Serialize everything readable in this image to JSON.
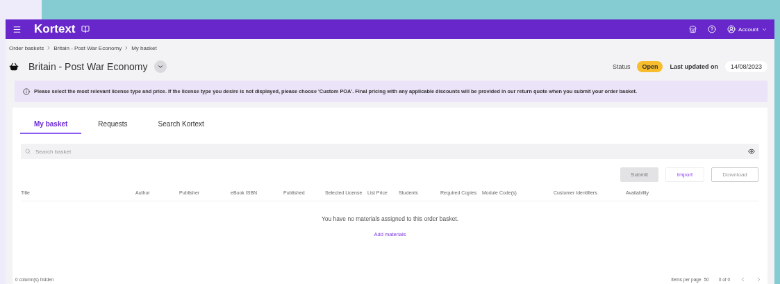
{
  "header": {
    "brand": "Kortext",
    "account": "Account"
  },
  "breadcrumbs": [
    "Order baskets",
    "Britain - Post War Economy",
    "My basket"
  ],
  "title": "Britain - Post War Economy",
  "status": {
    "label": "Status",
    "value": "Open"
  },
  "last_updated": {
    "label": "Last updated on",
    "value": "14/08/2023"
  },
  "notice": "Please select the most relevant license type and price. If the license type you desire is not displayed, please choose 'Custom POA'. Final pricing with any applicable discounts will be provided in our return quote when you submit your order basket.",
  "tabs": [
    {
      "label": "My basket",
      "selected": true
    },
    {
      "label": "Requests",
      "selected": false
    },
    {
      "label": "Search Kortext",
      "selected": false
    }
  ],
  "search": {
    "placeholder": "Search basket"
  },
  "buttons": [
    {
      "label": "Submit",
      "kind": "filled",
      "disabled": true
    },
    {
      "label": "Import",
      "kind": "outline",
      "disabled": false
    },
    {
      "label": "Download",
      "kind": "outline",
      "disabled": true
    }
  ],
  "columns": [
    "Title",
    "Author",
    "Publisher",
    "eBook ISBN",
    "Published",
    "Selected License",
    "List Price",
    "Students",
    "Required Copies",
    "Module Code(s)",
    "Customer Identifiers",
    "Availability"
  ],
  "empty_message": "You have no materials assigned to this order basket.",
  "add_link": "Add materials",
  "footer": {
    "hidden_columns": "0 column(s) hidden",
    "items_per_page_label": "Items per page",
    "items_per_page": "50",
    "range": "0 of 0"
  }
}
